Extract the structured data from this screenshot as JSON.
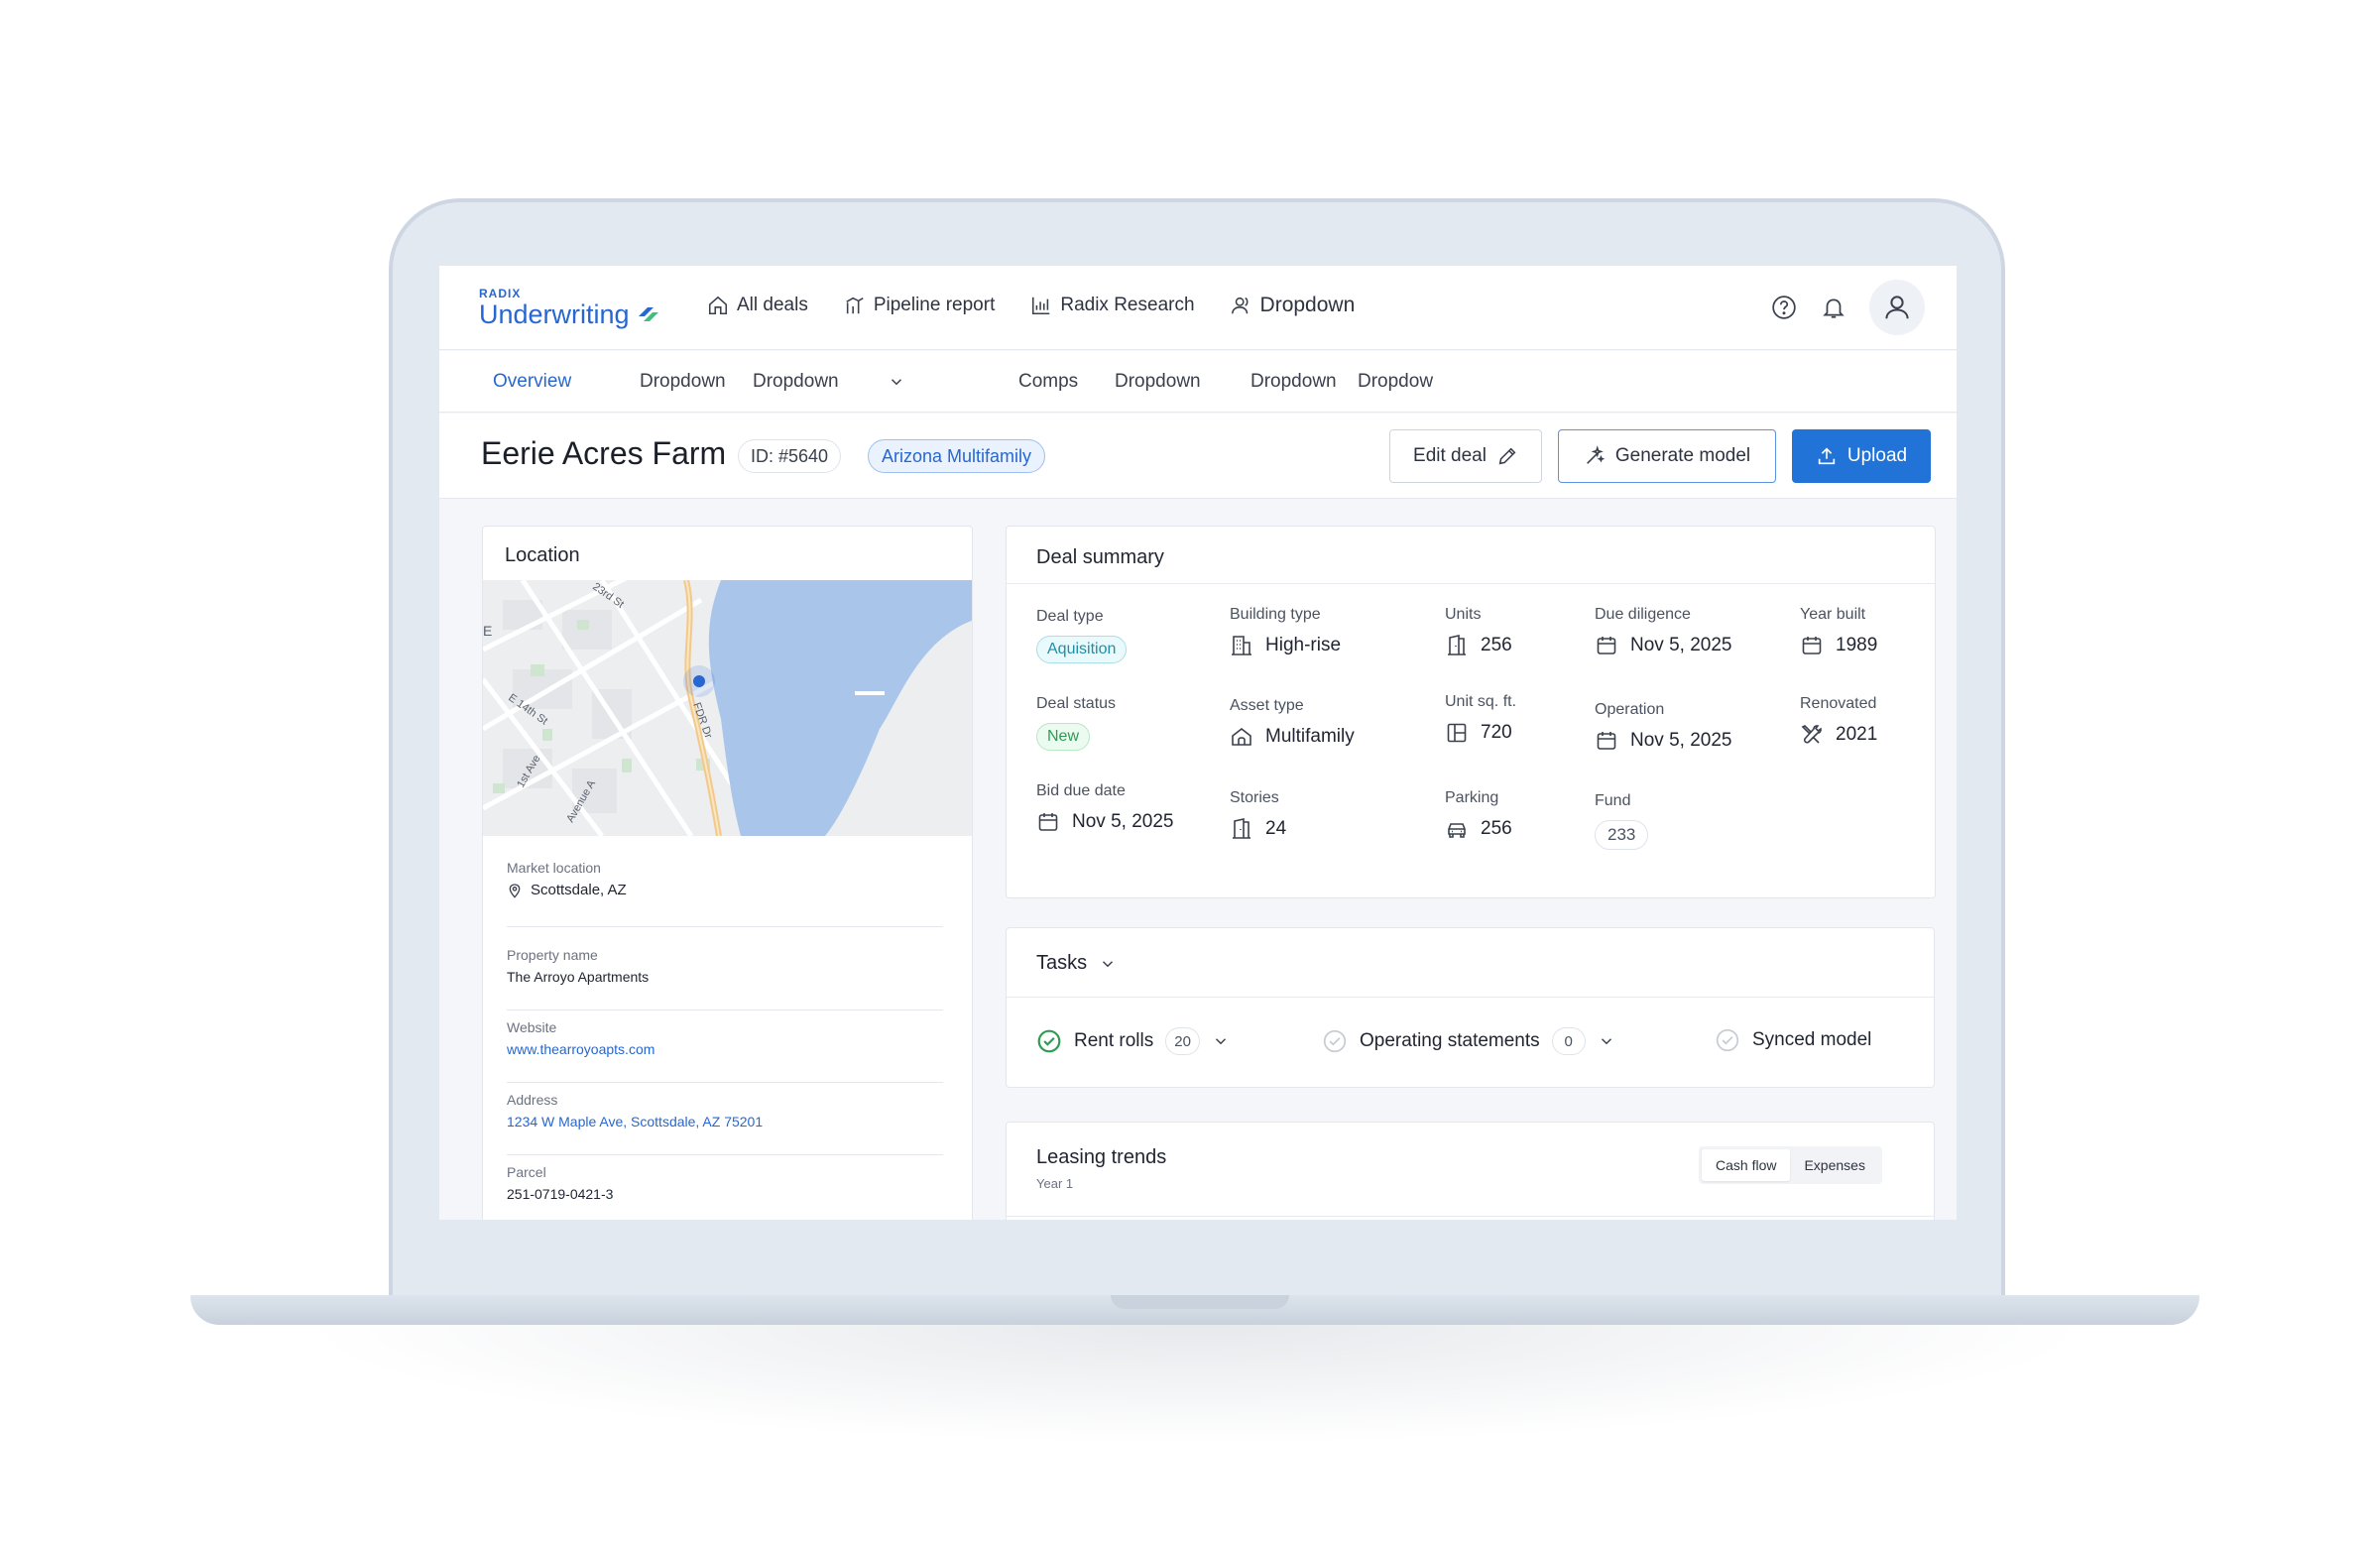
{
  "app": {
    "logo_small": "RADIX",
    "logo_main": "Underwriting"
  },
  "nav": {
    "items": [
      {
        "label": "All deals",
        "icon": "home-icon"
      },
      {
        "label": "Pipeline report",
        "icon": "pipeline-icon"
      },
      {
        "label": "Radix Research",
        "icon": "bar-chart-icon"
      },
      {
        "label": "Dropdown",
        "icon": "users-icon"
      }
    ]
  },
  "tabs": [
    {
      "label": "Overview",
      "active": true
    },
    {
      "label": "Dropdown"
    },
    {
      "label": "Dropdown"
    },
    {
      "label": "Comps"
    },
    {
      "label": "Dropdown"
    },
    {
      "label": "Dropdown"
    },
    {
      "label": "Dropdow"
    }
  ],
  "deal": {
    "title": "Eerie Acres Farm",
    "id": "ID: #5640",
    "tag": "Arizona Multifamily"
  },
  "actions": {
    "edit": "Edit deal",
    "generate": "Generate model",
    "upload": "Upload"
  },
  "location": {
    "title": "Location",
    "map_labels": {
      "street1": "E 14th St",
      "street2": "FDR Dr",
      "street3": "1st Ave",
      "street4": "Avenue A",
      "street5": "23rd St",
      "edge": "E"
    },
    "fields": [
      {
        "label": "Market location",
        "value": "Scottsdale, AZ",
        "icon": "map-pin-icon"
      },
      {
        "label": "Property name",
        "value": "The Arroyo Apartments"
      },
      {
        "label": "Website",
        "value": "www.thearroyoapts.com",
        "link": true
      },
      {
        "label": "Address",
        "value": "1234 W Maple Ave, Scottsdale, AZ 75201",
        "link": true
      },
      {
        "label": "Parcel",
        "value": "251-0719-0421-3"
      }
    ]
  },
  "summary": {
    "title": "Deal summary",
    "deal_type_label": "Deal type",
    "deal_type_value": "Aquisition",
    "deal_status_label": "Deal status",
    "deal_status_value": "New",
    "bid_due_label": "Bid due date",
    "bid_due_value": "Nov 5, 2025",
    "building_type_label": "Building type",
    "building_type_value": "High-rise",
    "asset_type_label": "Asset type",
    "asset_type_value": "Multifamily",
    "stories_label": "Stories",
    "stories_value": "24",
    "units_label": "Units",
    "units_value": "256",
    "unit_sqft_label": "Unit sq. ft.",
    "unit_sqft_value": "720",
    "parking_label": "Parking",
    "parking_value": "256",
    "due_diligence_label": "Due diligence",
    "due_diligence_value": "Nov 5, 2025",
    "operation_label": "Operation",
    "operation_value": "Nov 5, 2025",
    "fund_label": "Fund",
    "fund_value": "233",
    "year_built_label": "Year built",
    "year_built_value": "1989",
    "renovated_label": "Renovated",
    "renovated_value": "2021"
  },
  "tasks": {
    "title": "Tasks",
    "items": [
      {
        "label": "Rent rolls",
        "count": "20",
        "done": true
      },
      {
        "label": "Operating statements",
        "count": "0",
        "done": false
      },
      {
        "label": "Synced model",
        "done": false
      }
    ]
  },
  "leasing": {
    "title": "Leasing trends",
    "subtitle": "Year 1",
    "toggle": [
      "Cash flow",
      "Expenses"
    ],
    "selected": "Cash flow"
  },
  "colors": {
    "accent": "#2767d1",
    "upload_button": "#2273d8",
    "success": "#2e9b52",
    "map_water": "#a9c5ea"
  }
}
